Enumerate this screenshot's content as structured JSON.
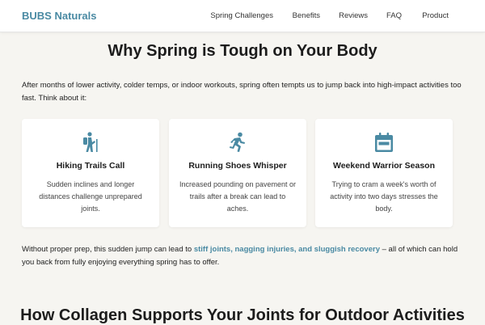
{
  "header": {
    "brand": "BUBS Naturals",
    "nav": [
      "Spring Challenges",
      "Benefits",
      "Reviews",
      "FAQ",
      "Product"
    ]
  },
  "section1": {
    "title": "Why Spring is Tough on Your Body",
    "intro": "After months of lower activity, colder temps, or indoor workouts, spring often tempts us to jump back into high-impact activities too fast. Think about it:",
    "cards": [
      {
        "icon": "hiking-icon",
        "title": "Hiking Trails Call",
        "desc": "Sudden inclines and longer distances challenge unprepared joints."
      },
      {
        "icon": "running-icon",
        "title": "Running Shoes Whisper",
        "desc": "Increased pounding on pavement or trails after a break can lead to aches."
      },
      {
        "icon": "calendar-icon",
        "title": "Weekend Warrior Season",
        "desc": "Trying to cram a week's worth of activity into two days stresses the body."
      }
    ],
    "outro_before": "Without proper prep, this sudden jump can lead to ",
    "outro_highlight": "stiff joints, nagging injuries, and sluggish recovery",
    "outro_after": " – all of which can hold you back from fully enjoying everything spring has to offer."
  },
  "section2": {
    "title": "How Collagen Supports Your Joints for Outdoor Activities"
  },
  "colors": {
    "accent": "#4a8aa3",
    "background": "#f6f5f1",
    "card": "#ffffff"
  }
}
